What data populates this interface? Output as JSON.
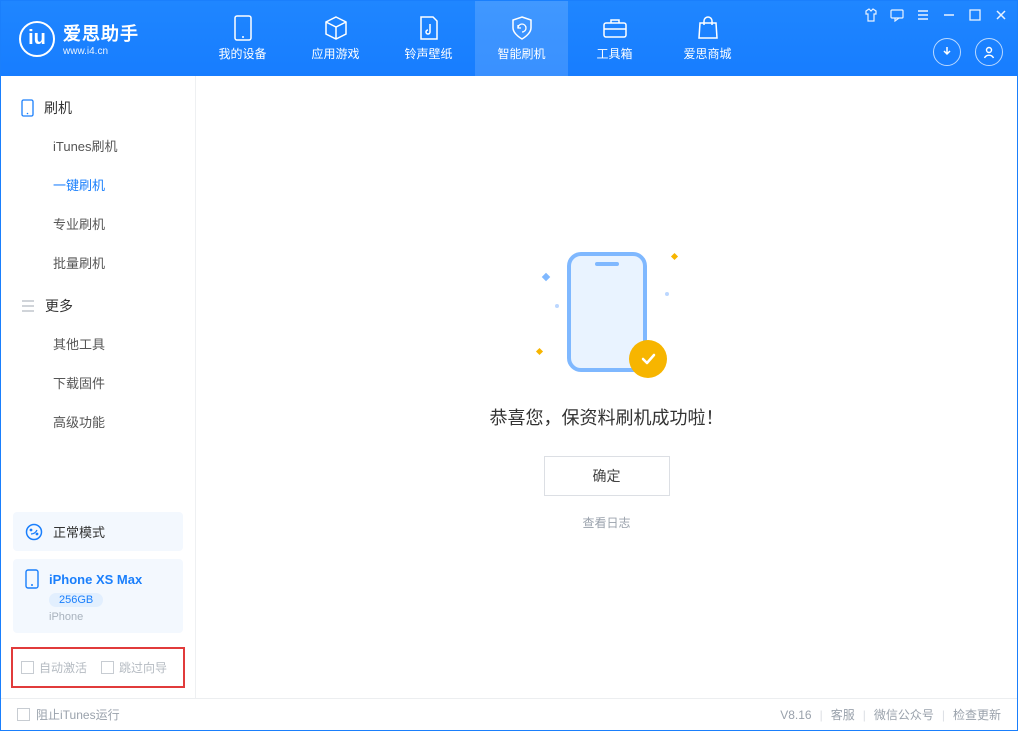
{
  "app": {
    "name": "爱思助手",
    "url": "www.i4.cn"
  },
  "nav": [
    {
      "label": "我的设备"
    },
    {
      "label": "应用游戏"
    },
    {
      "label": "铃声壁纸"
    },
    {
      "label": "智能刷机"
    },
    {
      "label": "工具箱"
    },
    {
      "label": "爱思商城"
    }
  ],
  "sidebar": {
    "group1": {
      "title": "刷机",
      "items": [
        "iTunes刷机",
        "一键刷机",
        "专业刷机",
        "批量刷机"
      ]
    },
    "group2": {
      "title": "更多",
      "items": [
        "其他工具",
        "下载固件",
        "高级功能"
      ]
    }
  },
  "modeCard": {
    "label": "正常模式"
  },
  "deviceCard": {
    "name": "iPhone XS Max",
    "storage": "256GB",
    "type": "iPhone"
  },
  "checks": {
    "autoActivate": "自动激活",
    "skipGuide": "跳过向导"
  },
  "main": {
    "successMsg": "恭喜您，保资料刷机成功啦！",
    "okBtn": "确定",
    "logLink": "查看日志"
  },
  "statusbar": {
    "blockItunes": "阻止iTunes运行",
    "version": "V8.16",
    "links": [
      "客服",
      "微信公众号",
      "检查更新"
    ]
  }
}
